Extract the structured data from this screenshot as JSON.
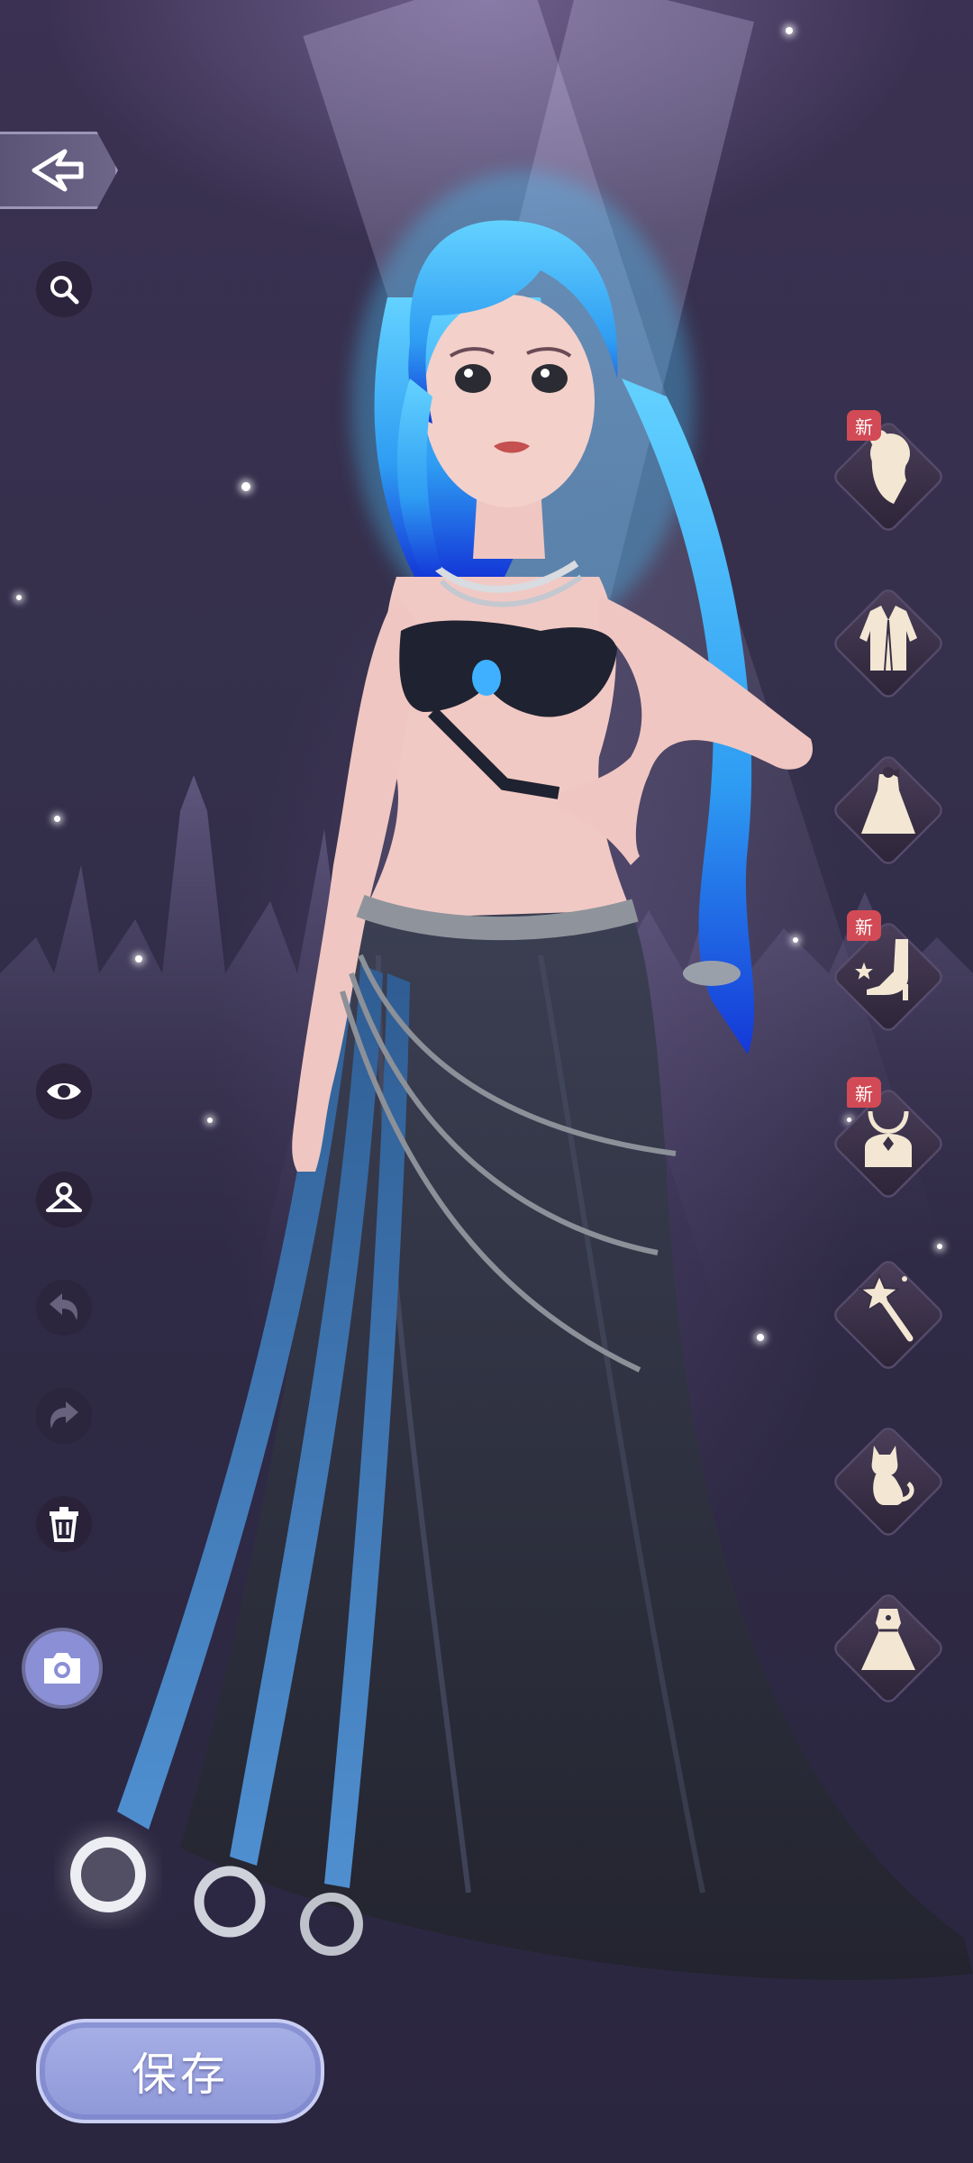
{
  "toolbar": {
    "back_icon": "back-arrow-icon",
    "search_icon": "search-icon"
  },
  "left_tools": [
    {
      "name": "eye-icon",
      "state": "active"
    },
    {
      "name": "hanger-icon",
      "state": "active"
    },
    {
      "name": "undo-icon",
      "state": "disabled"
    },
    {
      "name": "redo-icon",
      "state": "disabled"
    },
    {
      "name": "trash-icon",
      "state": "active"
    },
    {
      "name": "camera-icon",
      "state": "highlighted"
    }
  ],
  "categories": [
    {
      "name": "hairstyle-category-icon",
      "badge": "新"
    },
    {
      "name": "jacket-category-icon",
      "badge": ""
    },
    {
      "name": "dress-category-icon",
      "badge": ""
    },
    {
      "name": "shoes-category-icon",
      "badge": "新"
    },
    {
      "name": "necklace-category-icon",
      "badge": "新"
    },
    {
      "name": "wand-category-icon",
      "badge": ""
    },
    {
      "name": "cat-pet-category-icon",
      "badge": ""
    },
    {
      "name": "outfit-set-category-icon",
      "badge": ""
    }
  ],
  "save": {
    "label": "保存"
  },
  "colors": {
    "background": "#2f2a45",
    "accent": "#8f98d8",
    "badge": "#d24a55",
    "hair": "#3fb4ff"
  }
}
